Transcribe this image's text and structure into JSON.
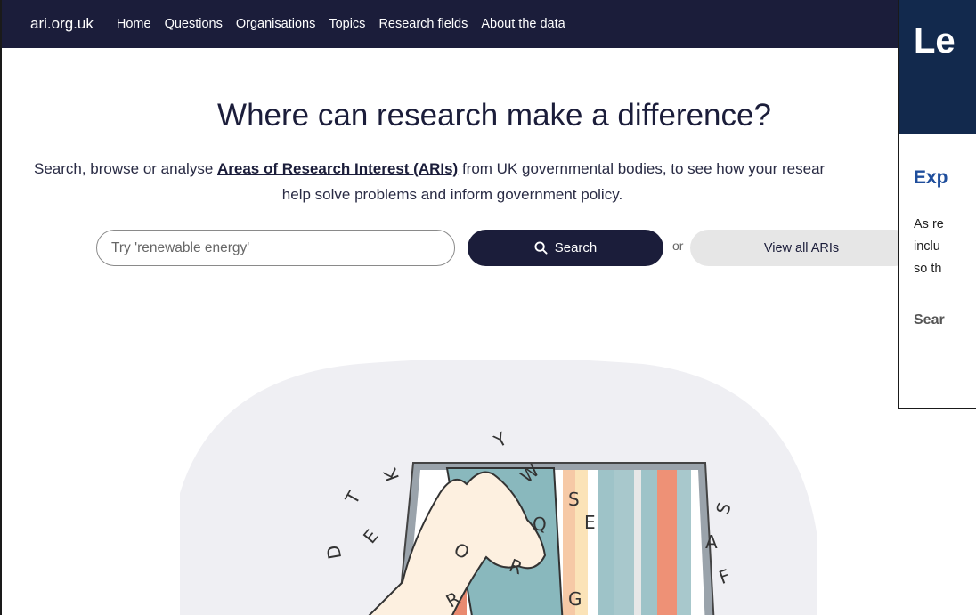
{
  "nav": {
    "brand": "ari.org.uk",
    "links": [
      "Home",
      "Questions",
      "Organisations",
      "Topics",
      "Research fields",
      "About the data"
    ]
  },
  "hero": {
    "title": "Where can research make a difference?",
    "sub_prefix": "Search, browse or analyse ",
    "sub_link": "Areas of Research Interest (ARIs)",
    "sub_suffix": " from UK governmental bodies, to see how your resear",
    "sub_line2": "help solve problems and inform government policy."
  },
  "search": {
    "placeholder": "Try 'renewable energy'",
    "button_label": "Search",
    "or_text": "or",
    "view_all_label": "View all ARIs"
  },
  "illustration": {
    "letters": [
      "Y",
      "K",
      "T",
      "W",
      "S",
      "E",
      "Q",
      "E",
      "D",
      "S",
      "A",
      "F",
      "O",
      "R",
      "G",
      "R"
    ]
  },
  "overlay": {
    "header": "Le",
    "heading": "Exp",
    "body_lines": [
      "As re",
      "inclu",
      "so th"
    ],
    "search_label": "Sear"
  },
  "colors": {
    "navy": "#1b1d3a",
    "overlay_header": "#12294d",
    "overlay_heading": "#1f4e9c",
    "button_grey": "#e6e6e6"
  }
}
